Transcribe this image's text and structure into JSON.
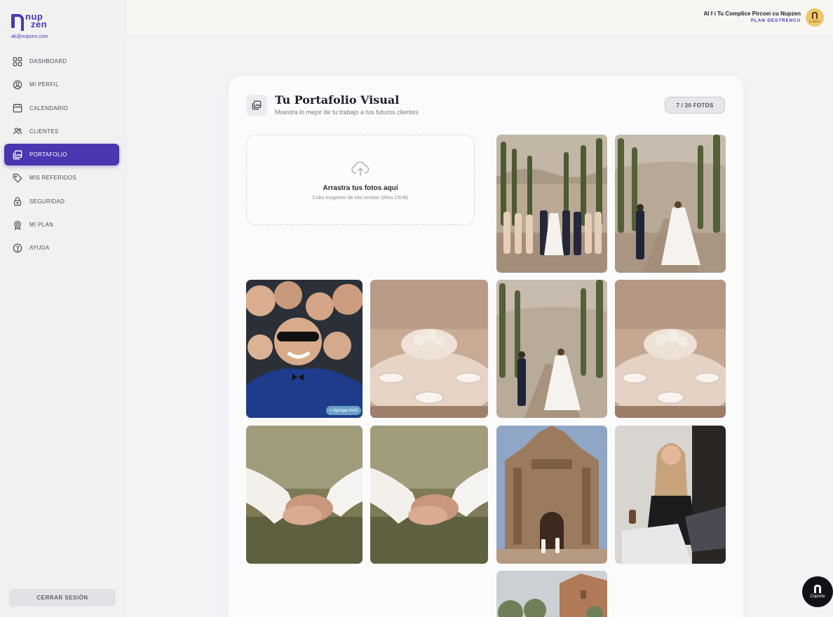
{
  "sidebar": {
    "logo": {
      "line1": "nup",
      "line2": "zen"
    },
    "email": "ak@nupzen.com",
    "items": [
      {
        "label": "DASHBOARD",
        "icon": "grid-icon"
      },
      {
        "label": "MI PERFIL",
        "icon": "user-circle-icon"
      },
      {
        "label": "CALENDARIO",
        "icon": "calendar-icon"
      },
      {
        "label": "CLIENTES",
        "icon": "users-icon"
      },
      {
        "label": "PORTAFOLIO",
        "icon": "gallery-icon",
        "active": true
      },
      {
        "label": "MIS REFERIDOS",
        "icon": "tag-icon"
      },
      {
        "label": "SEGURIDAD",
        "icon": "lock-icon"
      },
      {
        "label": "MI PLAN",
        "icon": "badge-icon"
      },
      {
        "label": "AYUDA",
        "icon": "help-circle-icon"
      }
    ],
    "logout_label": "CERRAR SESIÓN"
  },
  "header": {
    "user_name": "Al f i Tu Complice Pircoei cu Nupzen",
    "user_plan": "PLAN DESTRENCU",
    "avatar_text": "D-ISINTI"
  },
  "portfolio": {
    "title": "Tu Portafolio Visual",
    "subtitle": "Muestra lo mejor de tu trabajo a tus futuros clientes",
    "count_label": "7 / 20 FOTOS",
    "dropzone": {
      "title": "Arrastra tus fotos aquí",
      "subtitle": "Cubo incigones de oito cenitan (Wiss 15UB)"
    },
    "add_chip_label": "+ Agregar instil"
  },
  "support": {
    "label": "Coporte"
  },
  "colors": {
    "accent": "#4a36b0",
    "sidebar_bg": "#f1f1f1",
    "card_bg": "#fbfbfc"
  }
}
